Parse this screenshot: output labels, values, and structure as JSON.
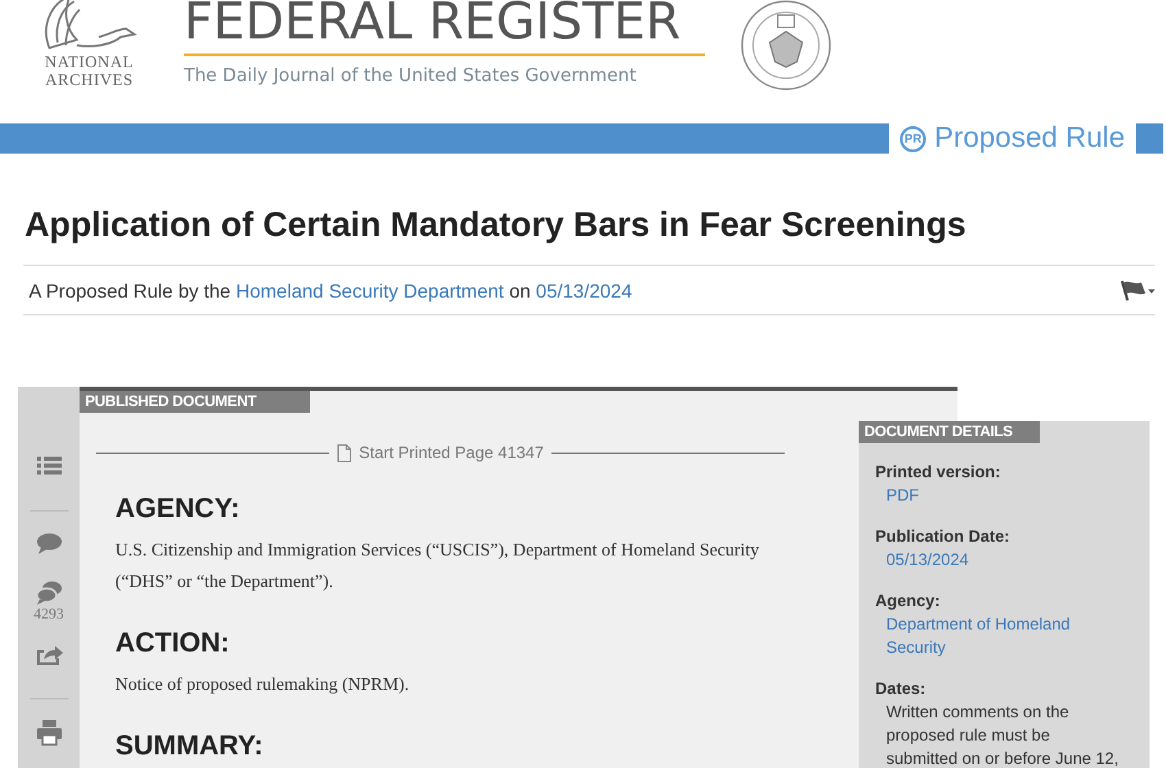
{
  "header": {
    "archives_label": "NATIONAL ARCHIVES",
    "site_title": "FEDERAL REGISTER",
    "tagline": "The Daily Journal of the United States Government"
  },
  "doc_type": {
    "badge": "PR",
    "label": "Proposed Rule"
  },
  "title": "Application of Certain Mandatory Bars in Fear Screenings",
  "byline": {
    "prefix": "A Proposed Rule by the",
    "agency": "Homeland Security Department",
    "joiner": "on",
    "date": "05/13/2024"
  },
  "toolbar": [
    {
      "kind": "contents"
    },
    {
      "kind": "divider"
    },
    {
      "kind": "comment"
    },
    {
      "kind": "comments",
      "count": "4293"
    },
    {
      "kind": "share"
    },
    {
      "kind": "divider"
    },
    {
      "kind": "print"
    }
  ],
  "document": {
    "tab": "PUBLISHED DOCUMENT",
    "page_marker": "Start Printed Page 41347",
    "sections": [
      {
        "heading": "AGENCY:",
        "body": "U.S. Citizenship and Immigration Services (“USCIS”), Department of Homeland Security (“DHS” or “the Department”)."
      },
      {
        "heading": "ACTION:",
        "body": "Notice of proposed rulemaking (NPRM)."
      },
      {
        "heading": "SUMMARY:"
      }
    ]
  },
  "details": {
    "tab": "DOCUMENT DETAILS",
    "items": [
      {
        "label": "Printed version:",
        "kind": "link",
        "value": "PDF"
      },
      {
        "label": "Publication Date:",
        "kind": "link",
        "value": "05/13/2024"
      },
      {
        "label": "Agency:",
        "kind": "link",
        "value": "Department of Homeland Security"
      },
      {
        "label": "Dates:",
        "kind": "text",
        "value": "Written comments on the proposed rule must be submitted on or before June 12,"
      }
    ]
  }
}
